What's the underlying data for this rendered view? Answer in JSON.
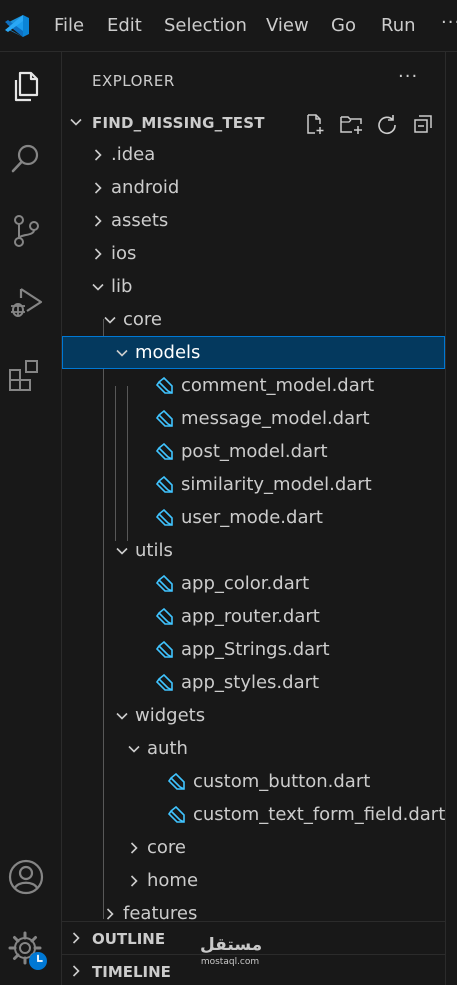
{
  "menu": {
    "file": "File",
    "edit": "Edit",
    "selection": "Selection",
    "view": "View",
    "go": "Go",
    "run": "Run",
    "more": "···"
  },
  "activity": [
    "files-icon",
    "search-icon",
    "source-control-icon",
    "run-debug-icon",
    "extensions-icon",
    "accounts-icon",
    "manage-gear-icon"
  ],
  "explorer": {
    "title": "EXPLORER",
    "more": "···",
    "project": "FIND_MISSING_TEST",
    "tree": [
      {
        "name": ".idea",
        "expanded": false
      },
      {
        "name": "android",
        "expanded": false
      },
      {
        "name": "assets",
        "expanded": false
      },
      {
        "name": "ios",
        "expanded": false
      },
      {
        "name": "lib",
        "expanded": true
      },
      {
        "name": "core",
        "expanded": true
      },
      {
        "name": "models",
        "expanded": true
      },
      {
        "name": "comment_model.dart"
      },
      {
        "name": "message_model.dart"
      },
      {
        "name": "post_model.dart"
      },
      {
        "name": "similarity_model.dart"
      },
      {
        "name": "user_mode.dart"
      },
      {
        "name": "utils",
        "expanded": true
      },
      {
        "name": "app_color.dart"
      },
      {
        "name": "app_router.dart"
      },
      {
        "name": "app_Strings.dart"
      },
      {
        "name": "app_styles.dart"
      },
      {
        "name": "widgets",
        "expanded": true
      },
      {
        "name": "auth",
        "expanded": true
      },
      {
        "name": "custom_button.dart"
      },
      {
        "name": "custom_text_form_field.dart"
      },
      {
        "name": "core",
        "expanded": false
      },
      {
        "name": "home",
        "expanded": false
      },
      {
        "name": "features",
        "expanded": false
      }
    ]
  },
  "sections": {
    "outline": "OUTLINE",
    "timeline": "TIMELINE"
  },
  "watermark": {
    "arabic": "مستقل",
    "latin": "mostaql.com"
  },
  "colors": {
    "accent": "#0078d4",
    "selection": "#04395e",
    "dart": "#40c4ff"
  }
}
